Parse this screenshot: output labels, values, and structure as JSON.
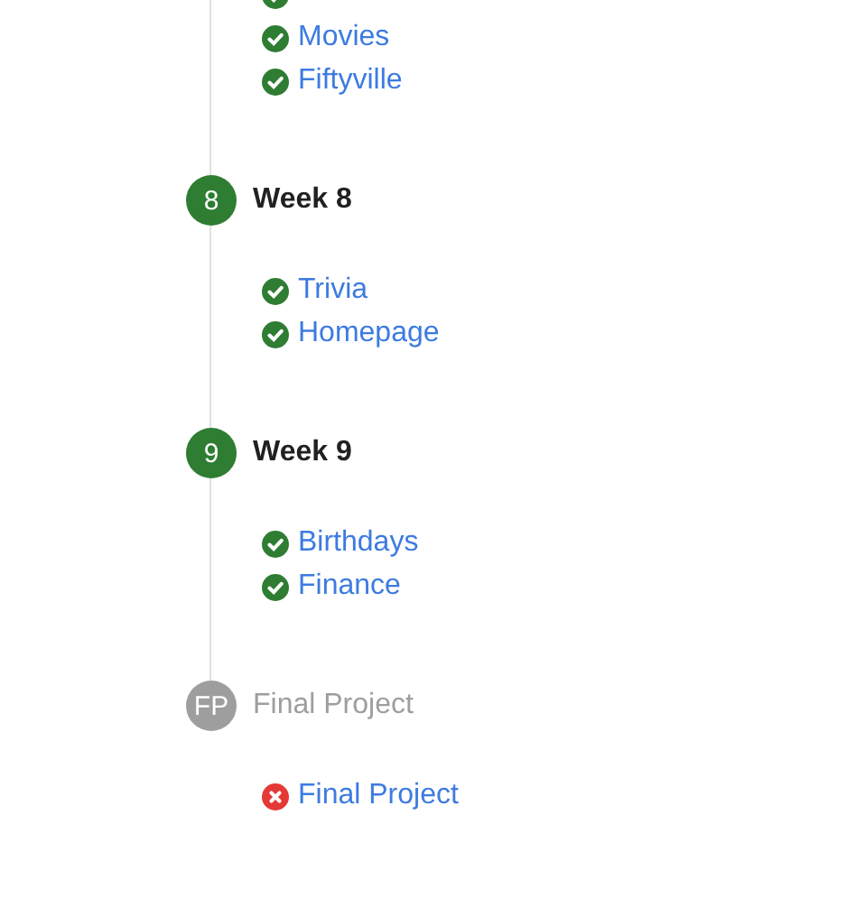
{
  "steps": [
    {
      "items": [
        {
          "completed": true
        },
        {
          "label": "Movies",
          "completed": true
        },
        {
          "label": "Fiftyville",
          "completed": true
        }
      ]
    },
    {
      "badge": "8",
      "title": "Week 8",
      "completed": true,
      "items": [
        {
          "label": "Trivia",
          "completed": true
        },
        {
          "label": "Homepage",
          "completed": true
        }
      ]
    },
    {
      "badge": "9",
      "title": "Week 9",
      "completed": true,
      "items": [
        {
          "label": "Birthdays",
          "completed": true
        },
        {
          "label": "Finance",
          "completed": true
        }
      ]
    },
    {
      "badge": "FP",
      "title": "Final Project",
      "completed": false,
      "items": [
        {
          "label": "Final Project",
          "completed": false
        }
      ]
    }
  ]
}
